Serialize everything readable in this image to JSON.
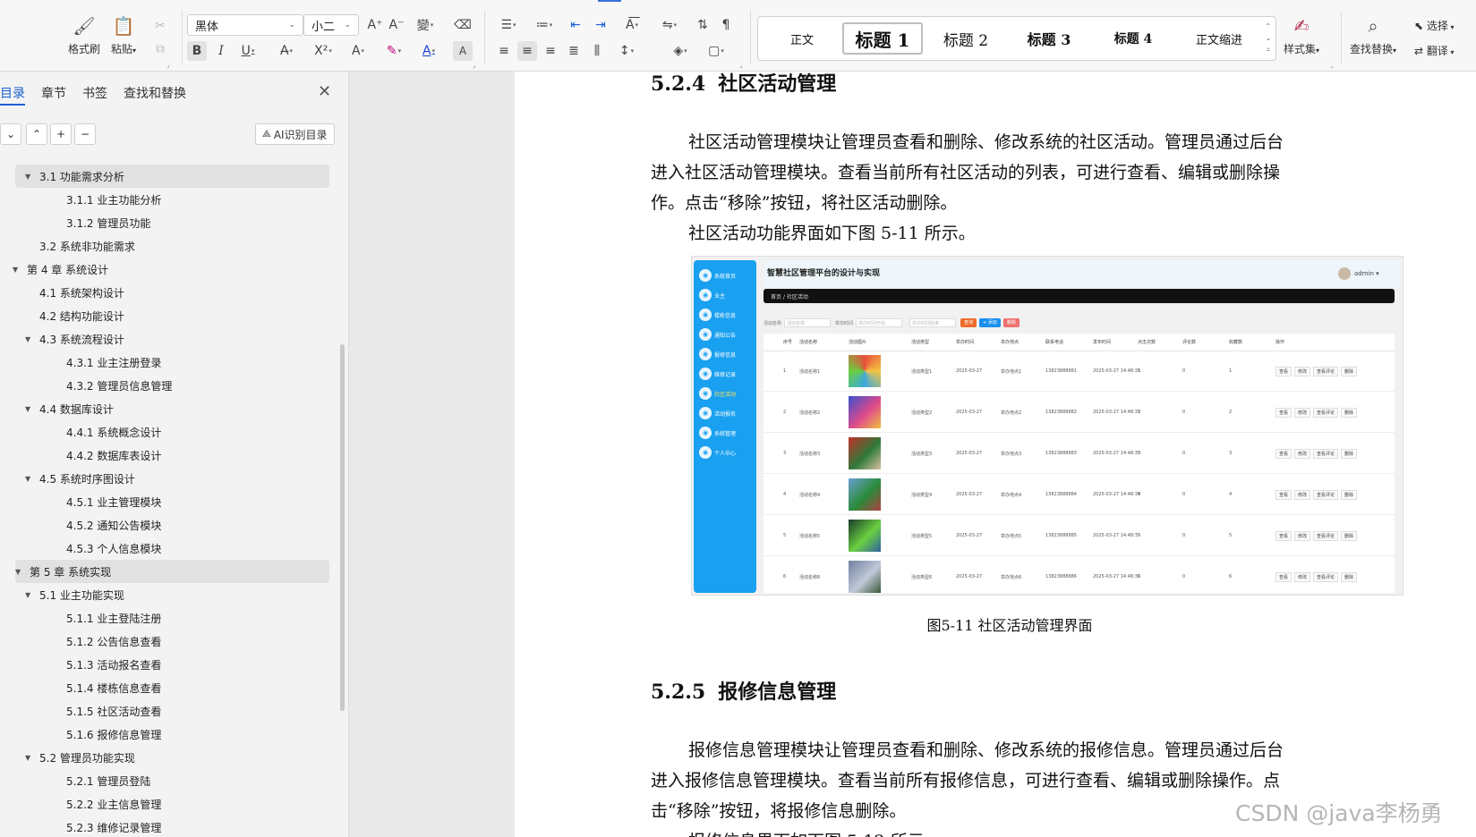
{
  "ribbon": {
    "format_painter": "格式刷",
    "paste": "粘贴",
    "font_name": "黑体",
    "font_size": "小二",
    "styles": [
      "正文",
      "标题 1",
      "标题 2",
      "标题 3",
      "标题 4",
      "正文缩进"
    ],
    "style_set": "样式集",
    "find_replace": "查找替换",
    "select": "选择",
    "translate": "翻译"
  },
  "nav": {
    "tabs": [
      "目录",
      "章节",
      "书签",
      "查找和替换"
    ],
    "ai_button": "AI识别目录",
    "toc": [
      {
        "text": "3.1  功能需求分析",
        "level": 2,
        "expanded": true,
        "highlight": true
      },
      {
        "text": "3.1.1  业主功能分析",
        "level": 3
      },
      {
        "text": "3.1.2  管理员功能",
        "level": 3
      },
      {
        "text": "3.2  系统非功能需求",
        "level": 2
      },
      {
        "text": "第 4 章  系统设计",
        "level": 1,
        "expanded": true
      },
      {
        "text": "4.1  系统架构设计",
        "level": 2
      },
      {
        "text": "4.2  结构功能设计",
        "level": 2
      },
      {
        "text": "4.3  系统流程设计",
        "level": 2,
        "expanded": true
      },
      {
        "text": "4.3.1  业主注册登录",
        "level": 3
      },
      {
        "text": "4.3.2 管理员信息管理",
        "level": 3
      },
      {
        "text": "4.4 数据库设计",
        "level": 2,
        "expanded": true
      },
      {
        "text": "4.4.1  系统概念设计",
        "level": 3
      },
      {
        "text": "4.4.2  数据库表设计",
        "level": 3
      },
      {
        "text": "4.5 系统时序图设计",
        "level": 2,
        "expanded": true
      },
      {
        "text": "4.5.1  业主管理模块",
        "level": 3
      },
      {
        "text": "4.5.2  通知公告模块",
        "level": 3
      },
      {
        "text": "4.5.3  个人信息模块",
        "level": 3
      },
      {
        "text": "第 5 章  系统实现",
        "level": 1,
        "expanded": true,
        "highlight": true
      },
      {
        "text": "5.1  业主功能实现",
        "level": 2,
        "expanded": true
      },
      {
        "text": "5.1.1  业主登陆注册",
        "level": 3
      },
      {
        "text": "5.1.2  公告信息查看",
        "level": 3
      },
      {
        "text": "5.1.3  活动报名查看",
        "level": 3
      },
      {
        "text": "5.1.4  楼栋信息查看",
        "level": 3
      },
      {
        "text": "5.1.5  社区活动查看",
        "level": 3
      },
      {
        "text": "5.1.6  报修信息管理",
        "level": 3
      },
      {
        "text": "5.2  管理员功能实现",
        "level": 2,
        "expanded": true
      },
      {
        "text": "5.2.1 管理员登陆",
        "level": 3
      },
      {
        "text": "5.2.2 业主信息管理",
        "level": 3
      },
      {
        "text": "5.2.3  维修记录管理",
        "level": 3
      }
    ]
  },
  "doc": {
    "sec1_num": "5.2.4",
    "sec1_title": "社区活动管理",
    "sec1_p1_l1": "社区活动管理模块让管理员查看和删除、修改系统的社区活动。管理员通过后台",
    "sec1_p1_l2": "进入社区活动管理模块。查看当前所有社区活动的列表，可进行查看、编辑或删除操",
    "sec1_p1_l3": "作。点击“移除”按钮，将社区活动删除。",
    "sec1_p2": "社区活动功能界面如下图 5-11 所示。",
    "caption": "图5-11  社区活动管理界面",
    "sec2_num": "5.2.5",
    "sec2_title": "报修信息管理",
    "sec2_p1_l1": "报修信息管理模块让管理员查看和删除、修改系统的报修信息。管理员通过后台",
    "sec2_p1_l2": "进入报修信息管理模块。查看当前所有报修信息，可进行查看、编辑或删除操作。点",
    "sec2_p1_l3": "击“移除”按钮，将报修信息删除。",
    "sec2_p2": "报修信息界面如下图 5-12 所示。",
    "watermark": "CSDN @java李杨勇"
  },
  "figure": {
    "title": "智慧社区管理平台的设计与实现",
    "admin": "admin ▾",
    "crumb": "首页  /  社区活动",
    "sidebar": [
      "系统首页",
      "业主",
      "楼栋信息",
      "通知公告",
      "报修信息",
      "维修记录",
      "社区活动",
      "活动报名",
      "系统管理",
      "个人中心"
    ],
    "filters": {
      "name_label": "活动名称",
      "name_ph": "活动名称",
      "time_label": "举办时间",
      "time_ph": "举办时间开始",
      "time_ph2": "举办时间结束",
      "btn_search": "查询",
      "btn_add": "+ 添加",
      "btn_del": "删除"
    },
    "columns": [
      "序号",
      "活动名称",
      "活动图片",
      "活动类型",
      "举办时间",
      "举办地点",
      "联系电话",
      "发布时间",
      "点击次数",
      "评论数",
      "收藏数",
      "操作"
    ],
    "rows": [
      [
        "1",
        "活动名称1",
        "活动类型1",
        "2025-03-27",
        "举办地点1",
        "13823888881",
        "2025-03-27 14:48:35",
        "1",
        "0",
        "1"
      ],
      [
        "2",
        "活动名称2",
        "活动类型2",
        "2025-03-27",
        "举办地点2",
        "13823888882",
        "2025-03-27 14:48:35",
        "2",
        "0",
        "2"
      ],
      [
        "3",
        "活动名称3",
        "活动类型3",
        "2025-03-27",
        "举办地点3",
        "13823888883",
        "2025-03-27 14:48:35",
        "3",
        "0",
        "3"
      ],
      [
        "4",
        "活动名称4",
        "活动类型4",
        "2025-03-27",
        "举办地点4",
        "13823888884",
        "2025-03-27 14:48:35",
        "4",
        "0",
        "4"
      ],
      [
        "5",
        "活动名称5",
        "活动类型5",
        "2025-03-27",
        "举办地点5",
        "13823888885",
        "2025-03-27 14:48:35",
        "5",
        "0",
        "5"
      ],
      [
        "6",
        "活动名称6",
        "活动类型6",
        "2025-03-27",
        "举办地点6",
        "13823888886",
        "2025-03-27 14:48:35",
        "6",
        "0",
        "6"
      ]
    ],
    "actions": [
      "查看",
      "修改",
      "查看评论",
      "删除"
    ]
  }
}
